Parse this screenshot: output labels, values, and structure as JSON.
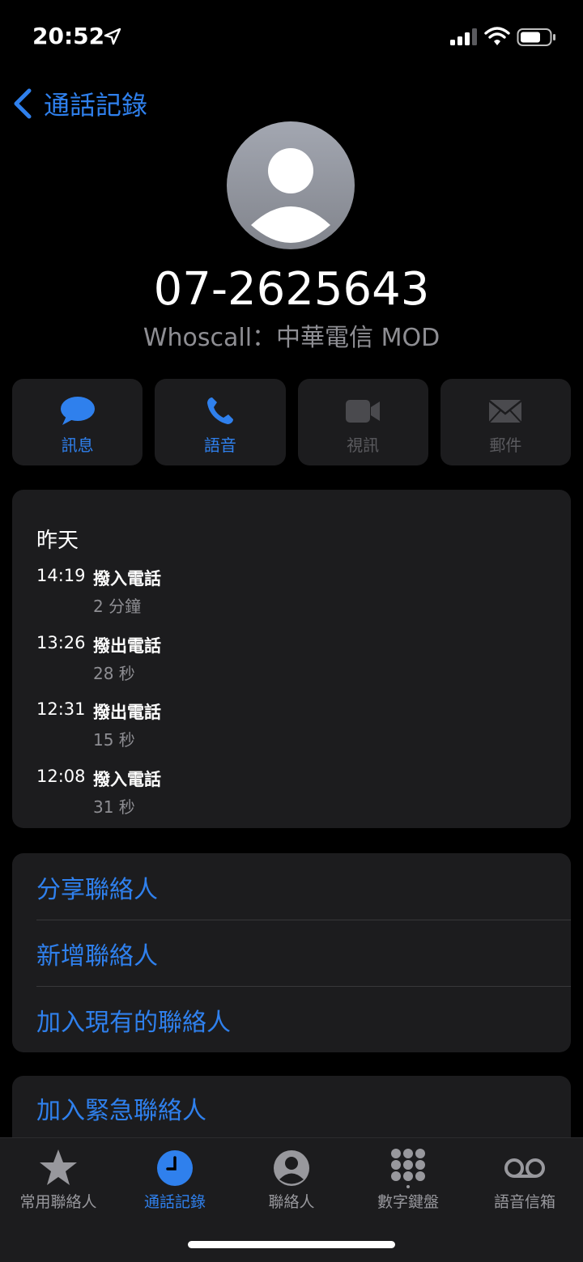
{
  "status": {
    "time": "20:52"
  },
  "nav": {
    "back_label": "通話記錄"
  },
  "contact": {
    "number": "07-2625643",
    "caller_id": "Whoscall：中華電信 MOD"
  },
  "actions": [
    {
      "label": "訊息",
      "icon": "message-icon",
      "enabled": true
    },
    {
      "label": "語音",
      "icon": "phone-icon",
      "enabled": true
    },
    {
      "label": "視訊",
      "icon": "video-icon",
      "enabled": false
    },
    {
      "label": "郵件",
      "icon": "mail-icon",
      "enabled": false
    }
  ],
  "history": {
    "date": "昨天",
    "calls": [
      {
        "time": "14:19",
        "type": "撥入電話",
        "duration": "2 分鐘"
      },
      {
        "time": "13:26",
        "type": "撥出電話",
        "duration": "28 秒"
      },
      {
        "time": "12:31",
        "type": "撥出電話",
        "duration": "15 秒"
      },
      {
        "time": "12:08",
        "type": "撥入電話",
        "duration": "31 秒"
      }
    ]
  },
  "contact_options": [
    "分享聯絡人",
    "新增聯絡人",
    "加入現有的聯絡人"
  ],
  "emergency": {
    "label": "加入緊急聯絡人"
  },
  "tabs": [
    {
      "label": "常用聯絡人",
      "icon": "star-icon",
      "active": false
    },
    {
      "label": "通話記錄",
      "icon": "clock-icon",
      "active": true
    },
    {
      "label": "聯絡人",
      "icon": "person-circle-icon",
      "active": false
    },
    {
      "label": "數字鍵盤",
      "icon": "keypad-icon",
      "active": false
    },
    {
      "label": "語音信箱",
      "icon": "voicemail-icon",
      "active": false
    }
  ],
  "colors": {
    "accent": "#2f80ed",
    "background": "#000000",
    "card": "#1c1c1e",
    "secondary_text": "#8e8e93"
  }
}
